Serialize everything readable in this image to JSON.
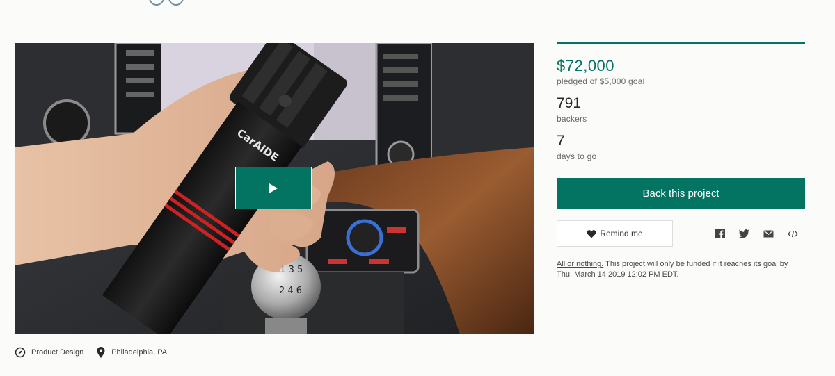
{
  "project": {
    "category": "Product Design",
    "location": "Philadelphia, PA",
    "brand_on_product": "CarAIDE"
  },
  "stats": {
    "pledged": "$72,000",
    "goal_text": "pledged of $5,000 goal",
    "backers_count": "791",
    "backers_label": "backers",
    "days_count": "7",
    "days_label": "days to go"
  },
  "actions": {
    "back_label": "Back this project",
    "remind_label": "Remind me"
  },
  "share_icons": [
    "facebook-icon",
    "twitter-icon",
    "email-icon",
    "embed-icon"
  ],
  "funding_note": {
    "link": "All or nothing.",
    "text": " This project will only be funded if it reaches its goal by Thu, March 14 2019 12:02 PM EDT."
  },
  "colors": {
    "accent": "#037362",
    "text": "#282828",
    "muted": "#656969"
  }
}
